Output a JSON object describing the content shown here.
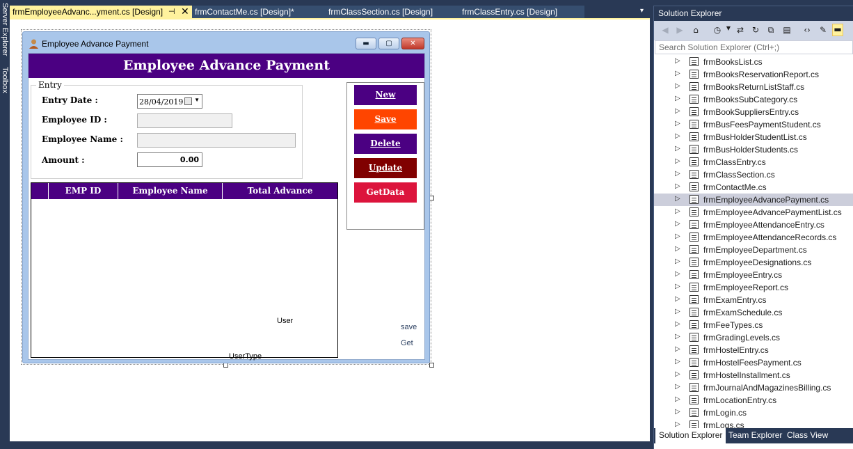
{
  "left_strip": {
    "items": [
      "Server Explorer",
      "Toolbox"
    ]
  },
  "tabs": [
    {
      "label": "frmEmployeeAdvanc...yment.cs [Design]",
      "pin_icon": "pin-icon",
      "close_icon": "close-icon"
    },
    {
      "label": "frmContactMe.cs [Design]*"
    },
    {
      "label": "frmClassSection.cs [Design]"
    },
    {
      "label": "frmClassEntry.cs [Design]"
    }
  ],
  "tab_overflow_icon": "▾",
  "form": {
    "window_title": "Employee Advance Payment",
    "banner_title": "Employee Advance Payment",
    "entry_group": {
      "legend": "Entry",
      "entry_date_label": "Entry Date :",
      "entry_date_value": "28/04/2019",
      "employee_id_label": "Employee ID :",
      "employee_id_value": "",
      "employee_name_label": "Employee Name :",
      "employee_name_value": "",
      "amount_label": "Amount :",
      "amount_value": "0.00"
    },
    "buttons": {
      "new": {
        "label": "New",
        "color": "#4B0082"
      },
      "save": {
        "label": "Save",
        "color": "#FF4500"
      },
      "delete": {
        "label": "Delete",
        "color": "#4B0082"
      },
      "update": {
        "label": "Update",
        "color": "#800000"
      },
      "getdata": {
        "label": "GetData",
        "color": "#DC143C"
      }
    },
    "grid": {
      "columns": [
        "EMP ID",
        "Employee Name",
        "Total Advance"
      ]
    },
    "labels": {
      "user": "User",
      "usertype": "UserType",
      "save": "save",
      "get": "Get"
    }
  },
  "solution_explorer": {
    "title": "Solution Explorer",
    "search_placeholder": "Search Solution Explorer (Ctrl+;)",
    "items": [
      "frmBooksList.cs",
      "frmBooksReservationReport.cs",
      "frmBooksReturnListStaff.cs",
      "frmBooksSubCategory.cs",
      "frmBookSuppliersEntry.cs",
      "frmBusFeesPaymentStudent.cs",
      "frmBusHolderStudentList.cs",
      "frmBusHolderStudents.cs",
      "frmClassEntry.cs",
      "frmClassSection.cs",
      "frmContactMe.cs",
      "frmEmployeeAdvancePayment.cs",
      "frmEmployeeAdvancePaymentList.cs",
      "frmEmployeeAttendanceEntry.cs",
      "frmEmployeeAttendanceRecords.cs",
      "frmEmployeeDepartment.cs",
      "frmEmployeeDesignations.cs",
      "frmEmployeeEntry.cs",
      "frmEmployeeReport.cs",
      "frmExamEntry.cs",
      "frmExamSchedule.cs",
      "frmFeeTypes.cs",
      "frmGradingLevels.cs",
      "frmHostelEntry.cs",
      "frmHostelFeesPayment.cs",
      "frmHostelInstallment.cs",
      "frmJournalAndMagazinesBilling.cs",
      "frmLocationEntry.cs",
      "frmLogin.cs",
      "frmLogs.cs"
    ],
    "selected_item": "frmEmployeeAdvancePayment.cs",
    "bottom_tabs": [
      "Solution Explorer",
      "Team Explorer",
      "Class View"
    ]
  }
}
